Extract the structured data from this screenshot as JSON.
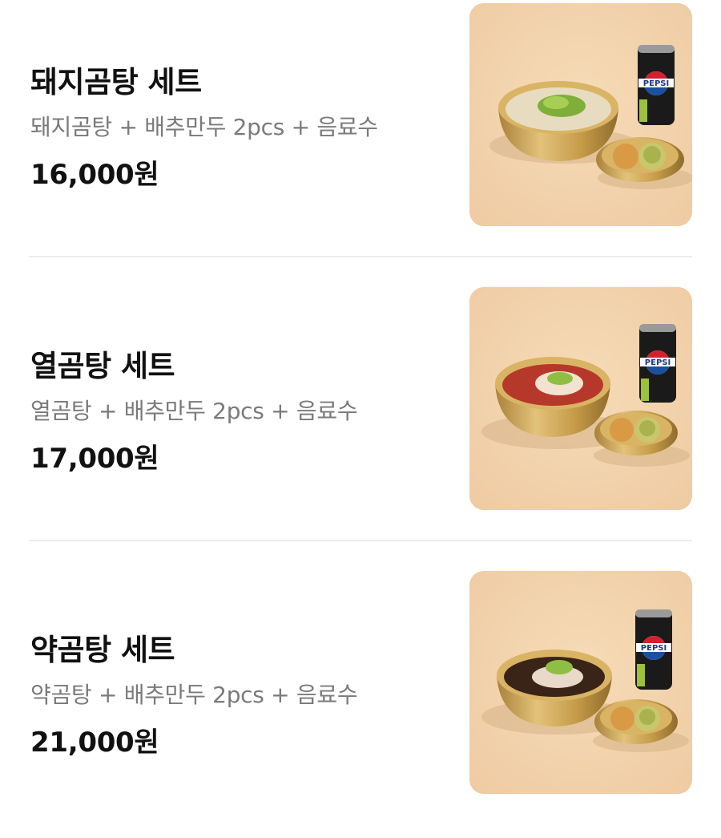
{
  "menu": {
    "items": [
      {
        "name": "돼지곰탕 세트",
        "description": "돼지곰탕 + 배추만두 2pcs + 음료수",
        "price": "16,000원",
        "soup_color": "#e8dcc0",
        "can_label": "PEPSI"
      },
      {
        "name": "열곰탕 세트",
        "description": "열곰탕 + 배추만두 2pcs + 음료수",
        "price": "17,000원",
        "soup_color": "#b5382a",
        "can_label": "PEPSI"
      },
      {
        "name": "약곰탕 세트",
        "description": "약곰탕 + 배추만두 2pcs + 음료수",
        "price": "21,000원",
        "soup_color": "#3a2418",
        "can_label": "PEPSI"
      }
    ]
  },
  "colors": {
    "background": "#ffffff",
    "photo_background": "#f2d3ad",
    "brass": "#c9a24e",
    "title_text": "#111111",
    "description_text": "#7a7a7a",
    "divider": "#ececec"
  }
}
